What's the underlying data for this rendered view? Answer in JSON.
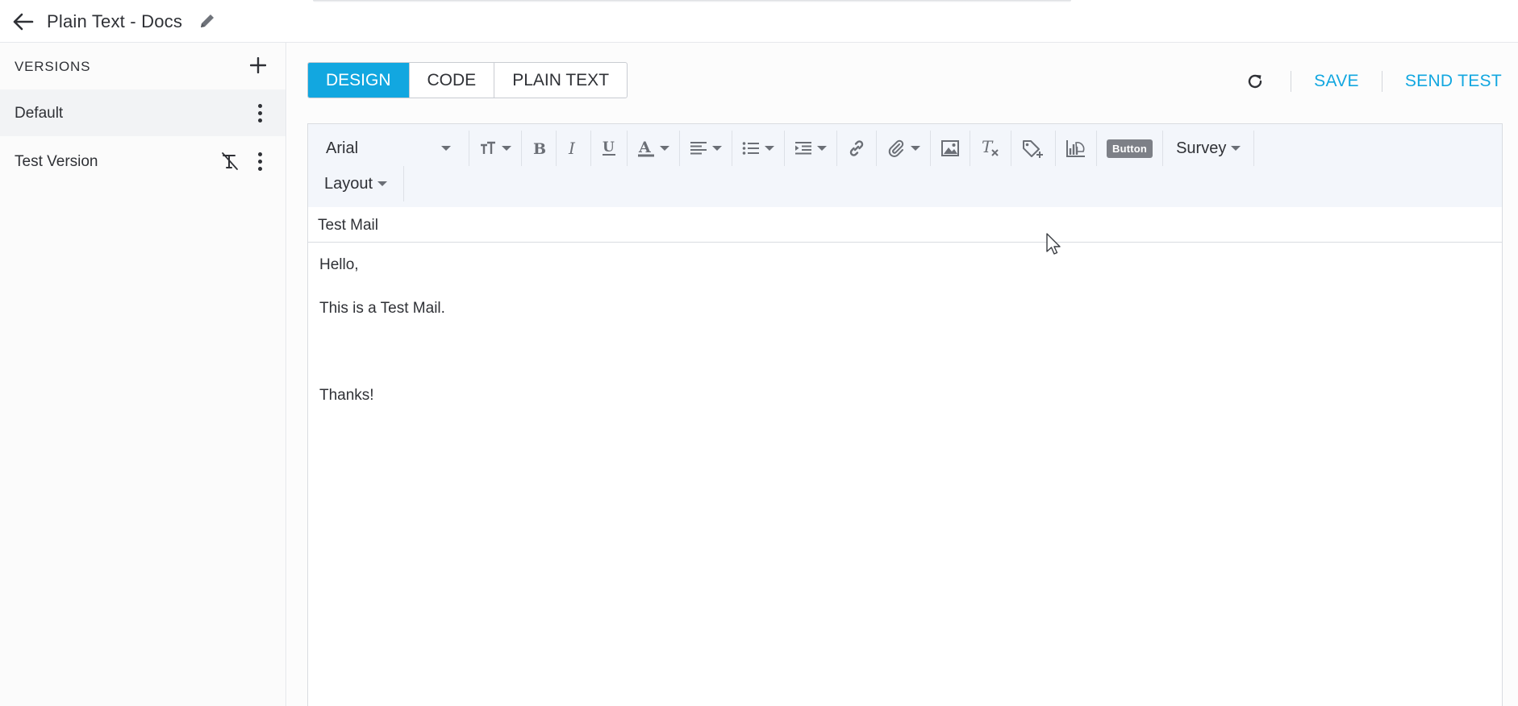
{
  "header": {
    "title": "Plain Text - Docs",
    "back_icon": "arrow-left-icon",
    "edit_icon": "pencil-icon"
  },
  "sidebar": {
    "heading": "VERSIONS",
    "add_icon": "plus-icon",
    "items": [
      {
        "label": "Default",
        "active": true
      },
      {
        "label": "Test Version",
        "active": false,
        "badge_icon": "plain-text-off-icon"
      }
    ]
  },
  "mode_tabs": [
    {
      "label": "DESIGN",
      "active": true
    },
    {
      "label": "CODE",
      "active": false
    },
    {
      "label": "PLAIN TEXT",
      "active": false
    }
  ],
  "actions": {
    "refresh_icon": "refresh-icon",
    "save_label": "SAVE",
    "send_test_label": "SEND TEST"
  },
  "toolbar": {
    "font_family": "Arial",
    "survey_label": "Survey",
    "layout_label": "Layout",
    "button_label": "Button"
  },
  "editor": {
    "subject": "Test Mail",
    "body_lines": [
      "Hello,",
      "This is a Test Mail.",
      "Thanks!"
    ]
  },
  "colors": {
    "accent": "#12a7e0",
    "text": "#2f3136",
    "toolbar_bg": "#f3f6fb"
  }
}
